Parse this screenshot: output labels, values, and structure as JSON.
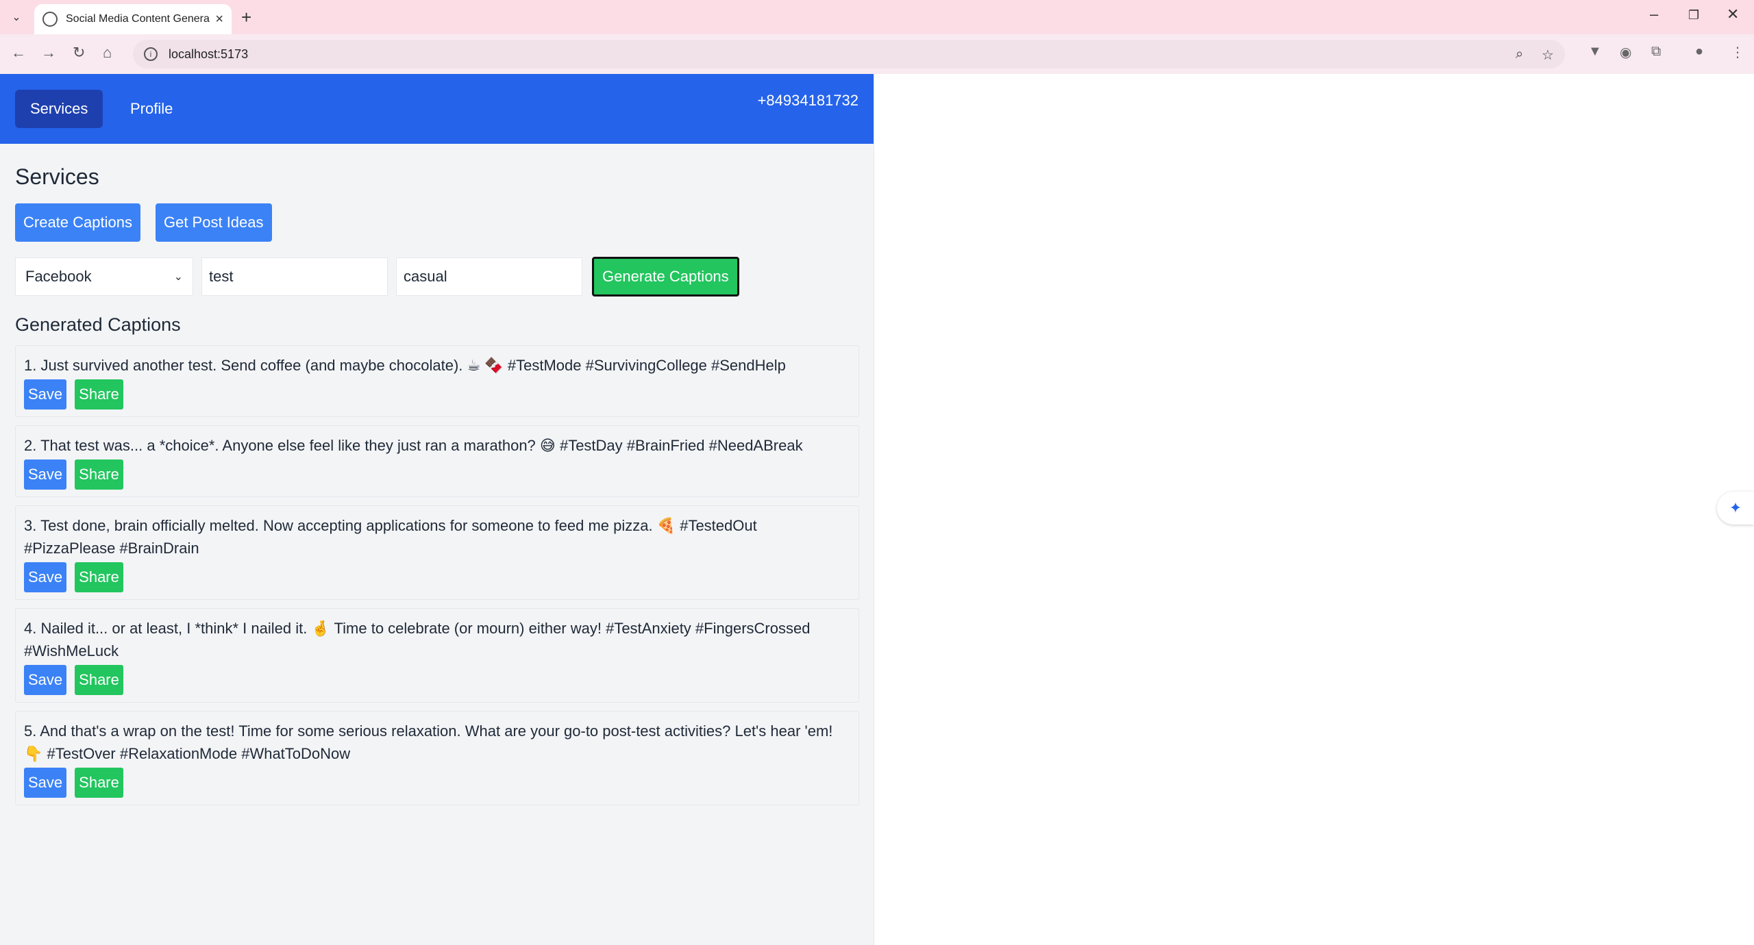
{
  "browser": {
    "tab_title": "Social Media Content Generator",
    "url": "localhost:5173"
  },
  "navbar": {
    "links": [
      {
        "label": "Services",
        "active": true
      },
      {
        "label": "Profile",
        "active": false
      }
    ],
    "phone": "+84934181732"
  },
  "page": {
    "title": "Services",
    "service_buttons": [
      "Create Captions",
      "Get Post Ideas"
    ]
  },
  "form": {
    "platform_selected": "Facebook",
    "topic_value": "test",
    "tone_value": "casual",
    "generate_label": "Generate Captions"
  },
  "captions_section": {
    "title": "Generated Captions",
    "save_label": "Save",
    "share_label": "Share",
    "items": [
      "1. Just survived another test. Send coffee (and maybe chocolate). ☕ 🍫 #TestMode #SurvivingCollege #SendHelp",
      "2. That test was... a *choice*. Anyone else feel like they just ran a marathon? 😅 #TestDay #BrainFried #NeedABreak",
      "3. Test done, brain officially melted. Now accepting applications for someone to feed me pizza. 🍕 #TestedOut #PizzaPlease #BrainDrain",
      "4. Nailed it... or at least, I *think* I nailed it. 🤞 Time to celebrate (or mourn) either way! #TestAnxiety #FingersCrossed #WishMeLuck",
      "5. And that's a wrap on the test! Time for some serious relaxation. What are your go-to post-test activities? Let's hear 'em! 👇 #TestOver #RelaxationMode #WhatToDoNow"
    ]
  },
  "colors": {
    "navbar": "#2563eb",
    "active_nav": "#1e40af",
    "primary_button": "#3b82f6",
    "success_button": "#22c55e"
  }
}
